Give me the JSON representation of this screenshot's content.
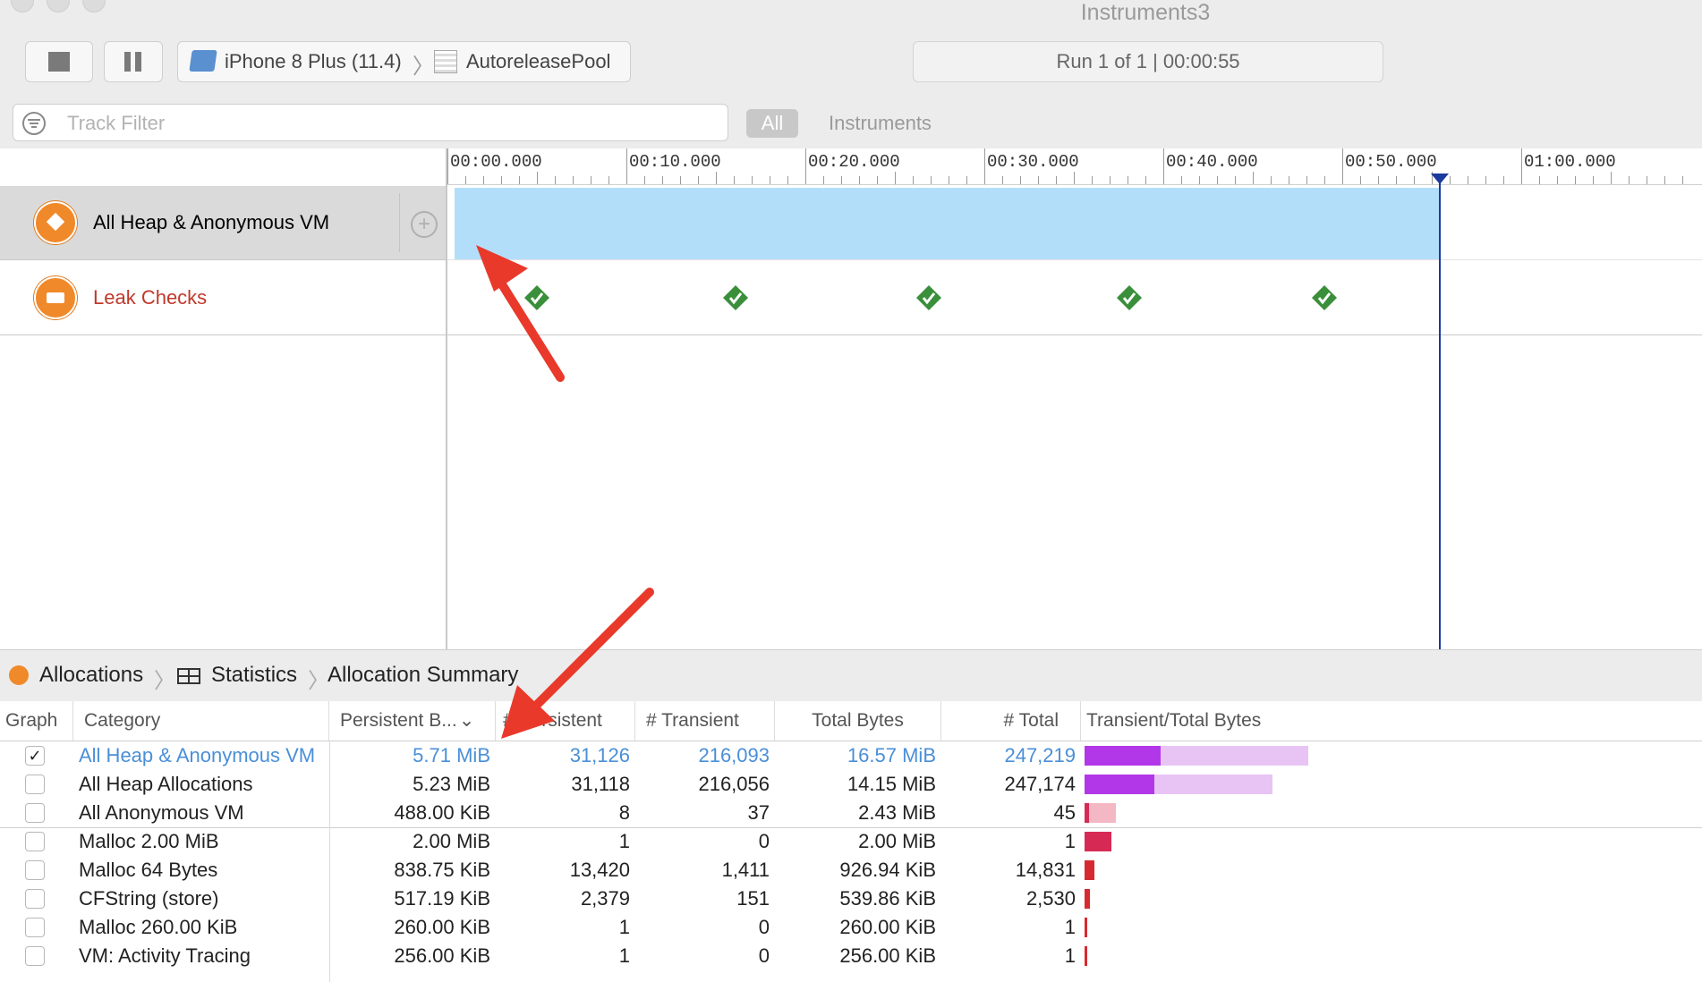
{
  "window": {
    "title": "Instruments3"
  },
  "toolbar": {
    "device": "iPhone 8 Plus (11.4)",
    "target": "AutoreleasePool",
    "run_status": "Run 1 of 1  |  00:00:55"
  },
  "filter": {
    "placeholder": "Track Filter",
    "scope_all": "All",
    "scope_instruments": "Instruments"
  },
  "ruler": {
    "labels": [
      "00:00.000",
      "00:10.000",
      "00:20.000",
      "00:30.000",
      "00:40.000",
      "00:50.000",
      "01:00.000"
    ]
  },
  "tracks": [
    {
      "label": "All Heap & Anonymous VM",
      "color": "#222222"
    },
    {
      "label": "Leak Checks",
      "color": "#c0392b"
    }
  ],
  "leak_check_count": 5,
  "jumpbar": {
    "item1": "Allocations",
    "item2": "Statistics",
    "item3": "Allocation Summary"
  },
  "table": {
    "headers": [
      "Graph",
      "Category",
      "Persistent B...",
      "# Persistent",
      "# Transient",
      "Total Bytes",
      "# Total",
      "Transient/Total Bytes"
    ],
    "rows": [
      {
        "checked": "✓",
        "category": "All Heap & Anonymous VM",
        "persistent_bytes": "5.71 MiB",
        "persistent": "31,126",
        "transient": "216,093",
        "total_bytes": "16.57 MiB",
        "total": "247,219",
        "highlight": true,
        "dark_frac": 0.34,
        "light_frac": 0.66,
        "dark_color": "#b237e8",
        "light_color": "#e8c4f5"
      },
      {
        "checked": "",
        "category": "All Heap Allocations",
        "persistent_bytes": "5.23 MiB",
        "persistent": "31,118",
        "transient": "216,056",
        "total_bytes": "14.15 MiB",
        "total": "247,174",
        "highlight": false,
        "dark_frac": 0.31,
        "light_frac": 0.53,
        "dark_color": "#b237e8",
        "light_color": "#e8c4f5"
      },
      {
        "checked": "",
        "category": "All Anonymous VM",
        "persistent_bytes": "488.00 KiB",
        "persistent": "8",
        "transient": "37",
        "total_bytes": "2.43 MiB",
        "total": "45",
        "highlight": false,
        "dark_frac": 0.02,
        "light_frac": 0.12,
        "dark_color": "#d62a55",
        "light_color": "#f4b8c4"
      },
      {
        "checked": "",
        "category": "Malloc 2.00 MiB",
        "persistent_bytes": "2.00 MiB",
        "persistent": "1",
        "transient": "0",
        "total_bytes": "2.00 MiB",
        "total": "1",
        "highlight": false,
        "dark_frac": 0.12,
        "light_frac": 0.0,
        "dark_color": "#d62a55",
        "light_color": "#f4b8c4"
      },
      {
        "checked": "",
        "category": "Malloc 64 Bytes",
        "persistent_bytes": "838.75 KiB",
        "persistent": "13,420",
        "transient": "1,411",
        "total_bytes": "926.94 KiB",
        "total": "14,831",
        "highlight": false,
        "dark_frac": 0.045,
        "light_frac": 0.0,
        "dark_color": "#d62a30",
        "light_color": "#f4b8c4"
      },
      {
        "checked": "",
        "category": "CFString (store)",
        "persistent_bytes": "517.19 KiB",
        "persistent": "2,379",
        "transient": "151",
        "total_bytes": "539.86 KiB",
        "total": "2,530",
        "highlight": false,
        "dark_frac": 0.025,
        "light_frac": 0.0,
        "dark_color": "#d62a30",
        "light_color": "#f4b8c4"
      },
      {
        "checked": "",
        "category": "Malloc 260.00 KiB",
        "persistent_bytes": "260.00 KiB",
        "persistent": "1",
        "transient": "0",
        "total_bytes": "260.00 KiB",
        "total": "1",
        "highlight": false,
        "dark_frac": 0.012,
        "light_frac": 0.0,
        "dark_color": "#d62a30",
        "light_color": "#f4b8c4"
      },
      {
        "checked": "",
        "category": "VM: Activity Tracing",
        "persistent_bytes": "256.00 KiB",
        "persistent": "1",
        "transient": "0",
        "total_bytes": "256.00 KiB",
        "total": "1",
        "highlight": false,
        "dark_frac": 0.012,
        "light_frac": 0.0,
        "dark_color": "#d62a30",
        "light_color": "#f4b8c4"
      }
    ]
  },
  "colors": {
    "heap_bar": "#b3defa",
    "playhead": "#1b3a9e",
    "annotation_arrow": "#e8392b",
    "check_green": "#3a8f3a"
  }
}
